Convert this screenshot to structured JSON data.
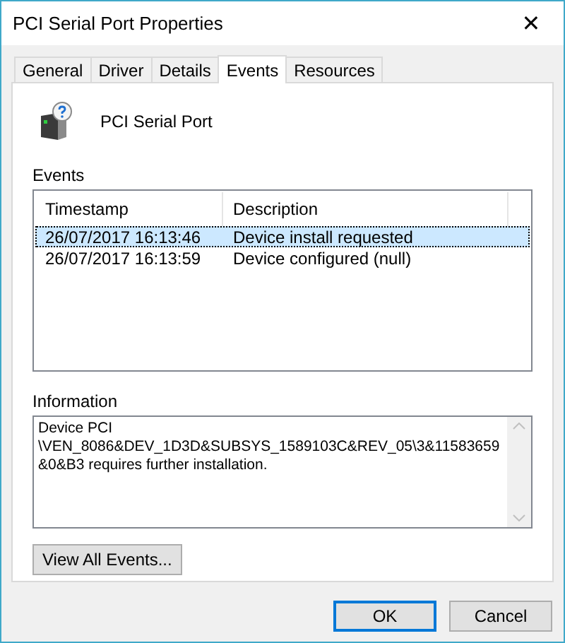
{
  "window": {
    "title": "PCI Serial Port Properties",
    "close": "✕"
  },
  "tabs": [
    {
      "label": "General",
      "selected": false
    },
    {
      "label": "Driver",
      "selected": false
    },
    {
      "label": "Details",
      "selected": false
    },
    {
      "label": "Events",
      "selected": true
    },
    {
      "label": "Resources",
      "selected": false
    }
  ],
  "device": {
    "name": "PCI Serial Port"
  },
  "events": {
    "label": "Events",
    "columns": [
      "Timestamp",
      "Description"
    ],
    "rows": [
      {
        "cells": [
          "26/07/2017 16:13:46",
          "Device install requested"
        ],
        "selected": true
      },
      {
        "cells": [
          "26/07/2017 16:13:59",
          "Device configured (null)"
        ],
        "selected": false
      }
    ]
  },
  "information": {
    "label": "Information",
    "lines": [
      "Device PCI",
      "\\VEN_8086&DEV_1D3D&SUBSYS_1589103C&REV_05\\3&11583659",
      "&0&B3 requires further installation."
    ]
  },
  "view_all_button": "View All Events...",
  "buttons": [
    {
      "label": "OK",
      "default": true
    },
    {
      "label": "Cancel",
      "default": false
    }
  ]
}
